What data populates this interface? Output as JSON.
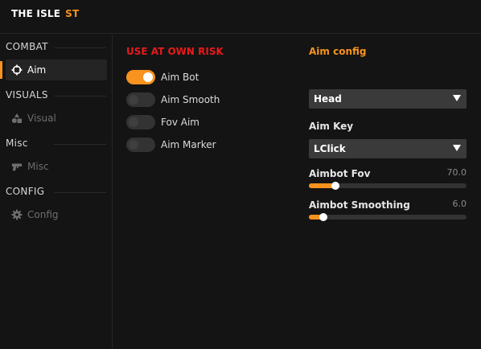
{
  "app": {
    "title": "THE ISLE",
    "title_accent": "ST"
  },
  "colors": {
    "accent": "#f7931e",
    "warning": "#e81a1a",
    "background": "#141414"
  },
  "sidebar": {
    "sections": [
      {
        "label": "COMBAT",
        "item": {
          "label": "Aim",
          "icon": "crosshair-icon",
          "active": true
        }
      },
      {
        "label": "VISUALS",
        "item": {
          "label": "Visual",
          "icon": "shapes-icon",
          "active": false
        }
      },
      {
        "label": "Misc",
        "item": {
          "label": "Misc",
          "icon": "gun-icon",
          "active": false
        }
      },
      {
        "label": "CONFIG",
        "item": {
          "label": "Config",
          "icon": "gear-icon",
          "active": false
        }
      }
    ]
  },
  "main": {
    "warning": "USE AT OWN RISK",
    "toggles": [
      {
        "label": "Aim Bot",
        "on": true
      },
      {
        "label": "Aim Smooth",
        "on": false
      },
      {
        "label": "Fov Aim",
        "on": false
      },
      {
        "label": "Aim Marker",
        "on": false
      }
    ]
  },
  "config": {
    "title": "Aim config",
    "bone_select": {
      "value": "Head"
    },
    "aim_key": {
      "label": "Aim Key",
      "value": "LClick"
    },
    "sliders": [
      {
        "label": "Aimbot Fov",
        "value": "70.0",
        "fill_fraction": 0.17
      },
      {
        "label": "Aimbot Smoothing",
        "value": "6.0",
        "fill_fraction": 0.09
      }
    ]
  }
}
